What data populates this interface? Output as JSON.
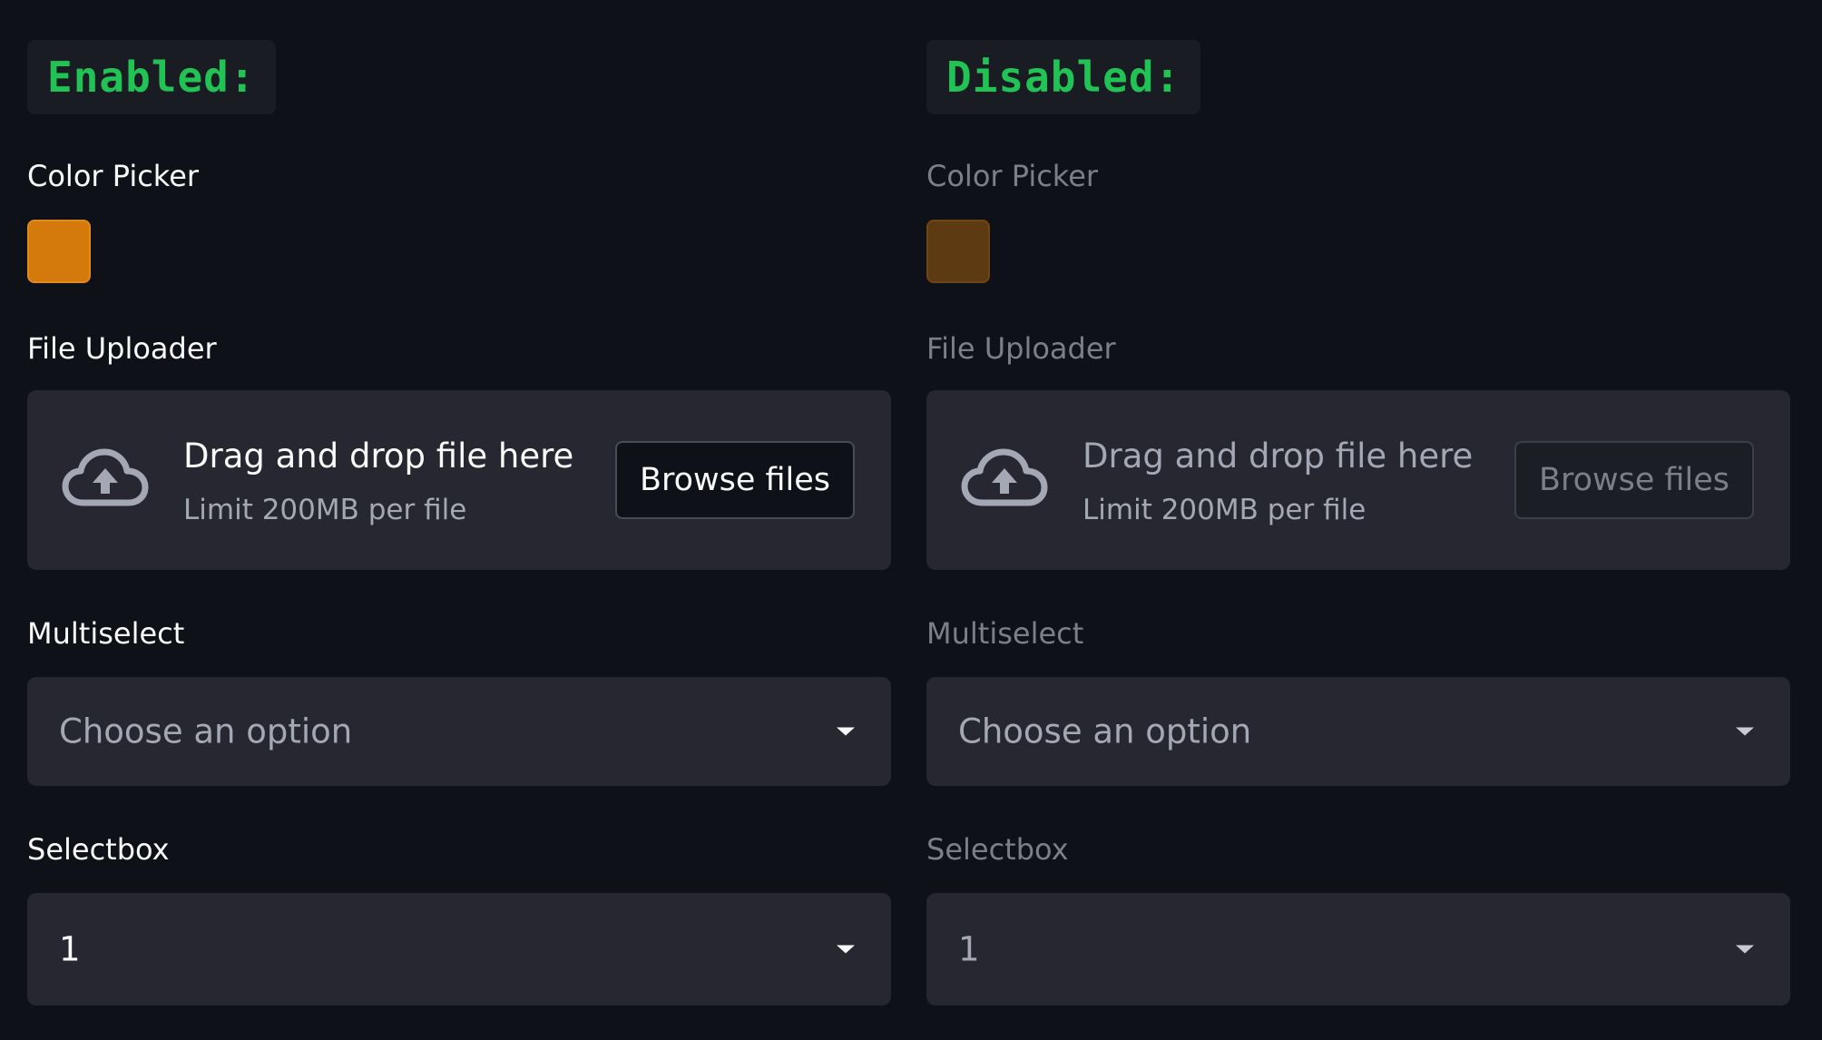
{
  "colors": {
    "background": "#0e1117",
    "header_text": "#21c354",
    "enabled_swatch": "#d4790b",
    "disabled_swatch": "#5e3a12"
  },
  "enabled": {
    "header": "Enabled:",
    "color_picker_label": "Color Picker",
    "file_uploader": {
      "label": "File Uploader",
      "icon": "cloud-upload-icon",
      "title": "Drag and drop file here",
      "limit": "Limit 200MB per file",
      "button": "Browse files"
    },
    "multiselect": {
      "label": "Multiselect",
      "placeholder": "Choose an option"
    },
    "selectbox": {
      "label": "Selectbox",
      "value": "1"
    }
  },
  "disabled": {
    "header": "Disabled:",
    "color_picker_label": "Color Picker",
    "file_uploader": {
      "label": "File Uploader",
      "icon": "cloud-upload-icon",
      "title": "Drag and drop file here",
      "limit": "Limit 200MB per file",
      "button": "Browse files"
    },
    "multiselect": {
      "label": "Multiselect",
      "placeholder": "Choose an option"
    },
    "selectbox": {
      "label": "Selectbox",
      "value": "1"
    }
  }
}
